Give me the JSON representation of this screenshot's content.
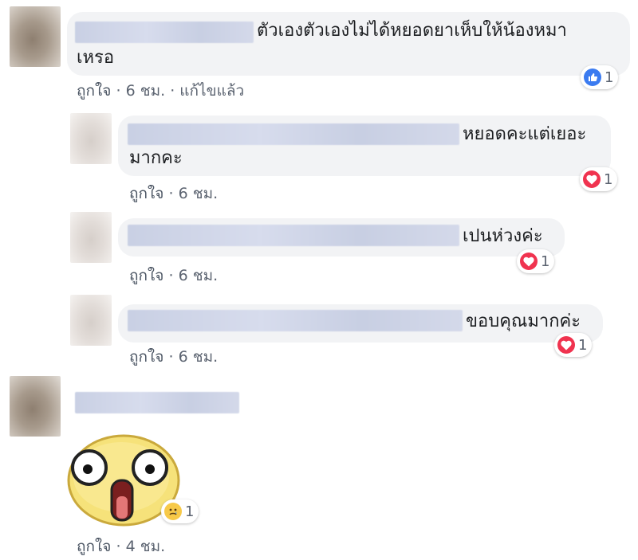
{
  "comments": [
    {
      "text_line1": "ตัวเองตัวเองไม่ได้หยอดยาเห็บให้น้องหมา",
      "text_line2": "เหรอ",
      "like": "ถูกใจ",
      "dot": "·",
      "time": "6 ชม.",
      "dot2": "·",
      "edited": "แก้ไขแล้ว",
      "reaction": {
        "icon": "like-reaction-icon",
        "count": "1"
      }
    },
    {
      "text_line1": "หยอดคะแต่เยอะ",
      "text_line2": "มากคะ",
      "like": "ถูกใจ",
      "dot": "·",
      "time": "6 ชม.",
      "reaction": {
        "icon": "heart-reaction-icon",
        "count": "1"
      }
    },
    {
      "text_line1": "เปนห่วงค่ะ",
      "like": "ถูกใจ",
      "dot": "·",
      "time": "6 ชม.",
      "reaction": {
        "icon": "heart-reaction-icon",
        "count": "1"
      }
    },
    {
      "text_line1": "ขอบคุณมากค่ะ",
      "like": "ถูกใจ",
      "dot": "·",
      "time": "6 ชม.",
      "reaction": {
        "icon": "heart-reaction-icon",
        "count": "1"
      }
    },
    {
      "sticker": "shocked-face-sticker",
      "like": "ถูกใจ",
      "dot": "·",
      "time": "4 ชม.",
      "reaction": {
        "icon": "sad-reaction-icon",
        "count": "1"
      }
    }
  ],
  "colors": {
    "bubble": "#f2f3f5",
    "like_blue": "#3b7bf0",
    "heart_red": "#f0334f",
    "sad_yellow": "#f7c948",
    "meta_gray": "#5b6370"
  }
}
